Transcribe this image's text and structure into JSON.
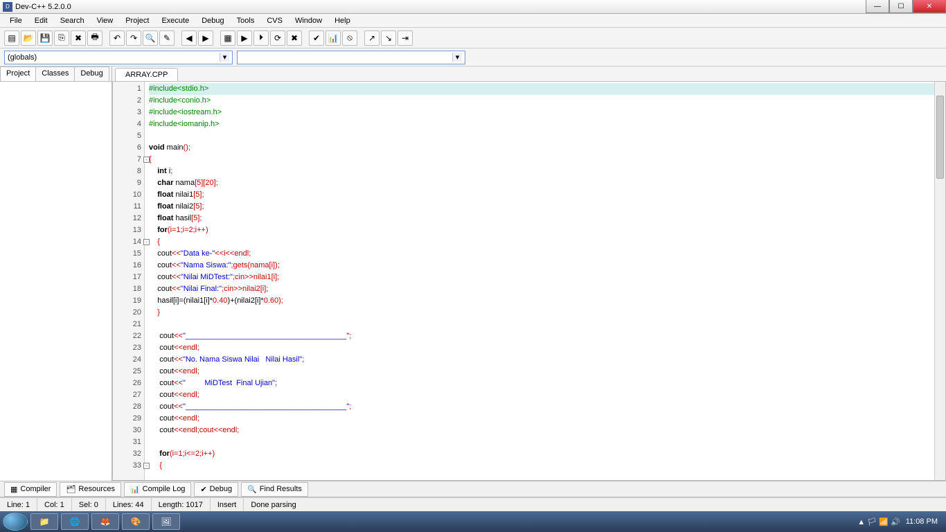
{
  "title": "Dev-C++ 5.2.0.0",
  "window_buttons": {
    "min": "—",
    "max": "☐",
    "close": "✕"
  },
  "menus": [
    "File",
    "Edit",
    "Search",
    "View",
    "Project",
    "Execute",
    "Debug",
    "Tools",
    "CVS",
    "Window",
    "Help"
  ],
  "toolbar_icons": [
    "new-file",
    "open-file",
    "save",
    "save-all",
    "close",
    "print",
    "",
    "undo",
    "redo",
    "find",
    "replace",
    "",
    "back",
    "forward",
    "",
    "compile",
    "run",
    "compile-run",
    "rebuild",
    "debug-btn",
    "",
    "check",
    "profile",
    "stop",
    "",
    "goto1",
    "goto2",
    "goto3"
  ],
  "combo1": "(globals)",
  "combo2": "",
  "left_tabs": [
    "Project",
    "Classes",
    "Debug"
  ],
  "editor_tab": "ARRAY.CPP",
  "code_lines": [
    {
      "n": 1,
      "hl": true,
      "segs": [
        {
          "t": "#include<stdio.h>",
          "c": "pre"
        }
      ]
    },
    {
      "n": 2,
      "segs": [
        {
          "t": "#include<conio.h>",
          "c": "pre"
        }
      ]
    },
    {
      "n": 3,
      "segs": [
        {
          "t": "#include<iostream.h>",
          "c": "pre"
        }
      ]
    },
    {
      "n": 4,
      "segs": [
        {
          "t": "#include<iomanip.h>",
          "c": "pre"
        }
      ]
    },
    {
      "n": 5,
      "segs": []
    },
    {
      "n": 6,
      "segs": [
        {
          "t": "void",
          "c": "kw"
        },
        {
          "t": " main",
          "c": "id"
        },
        {
          "t": "();",
          "c": "sym"
        }
      ]
    },
    {
      "n": 7,
      "fold": "-",
      "segs": [
        {
          "t": "{",
          "c": "sym"
        }
      ]
    },
    {
      "n": 8,
      "segs": [
        {
          "t": "    ",
          "c": "id"
        },
        {
          "t": "int",
          "c": "kw"
        },
        {
          "t": " i",
          "c": "id"
        },
        {
          "t": ";",
          "c": "sym"
        }
      ]
    },
    {
      "n": 9,
      "segs": [
        {
          "t": "    ",
          "c": "id"
        },
        {
          "t": "char",
          "c": "kw"
        },
        {
          "t": " nama",
          "c": "id"
        },
        {
          "t": "[",
          "c": "sym"
        },
        {
          "t": "5",
          "c": "num"
        },
        {
          "t": "][",
          "c": "sym"
        },
        {
          "t": "20",
          "c": "num"
        },
        {
          "t": "];",
          "c": "sym"
        }
      ]
    },
    {
      "n": 10,
      "segs": [
        {
          "t": "    ",
          "c": "id"
        },
        {
          "t": "float",
          "c": "kw"
        },
        {
          "t": " nilai1",
          "c": "id"
        },
        {
          "t": "[",
          "c": "sym"
        },
        {
          "t": "5",
          "c": "num"
        },
        {
          "t": "];",
          "c": "sym"
        }
      ]
    },
    {
      "n": 11,
      "segs": [
        {
          "t": "    ",
          "c": "id"
        },
        {
          "t": "float",
          "c": "kw"
        },
        {
          "t": " nilai2",
          "c": "id"
        },
        {
          "t": "[",
          "c": "sym"
        },
        {
          "t": "5",
          "c": "num"
        },
        {
          "t": "];",
          "c": "sym"
        }
      ]
    },
    {
      "n": 12,
      "segs": [
        {
          "t": "    ",
          "c": "id"
        },
        {
          "t": "float",
          "c": "kw"
        },
        {
          "t": " hasil",
          "c": "id"
        },
        {
          "t": "[",
          "c": "sym"
        },
        {
          "t": "5",
          "c": "num"
        },
        {
          "t": "];",
          "c": "sym"
        }
      ]
    },
    {
      "n": 13,
      "segs": [
        {
          "t": "    ",
          "c": "id"
        },
        {
          "t": "for",
          "c": "kw"
        },
        {
          "t": "(i=",
          "c": "sym"
        },
        {
          "t": "1",
          "c": "num"
        },
        {
          "t": ";i=",
          "c": "sym"
        },
        {
          "t": "2",
          "c": "num"
        },
        {
          "t": ";i++)",
          "c": "sym"
        }
      ]
    },
    {
      "n": 14,
      "fold": "-",
      "segs": [
        {
          "t": "    {",
          "c": "sym"
        }
      ]
    },
    {
      "n": 15,
      "segs": [
        {
          "t": "    cout",
          "c": "id"
        },
        {
          "t": "<<",
          "c": "sym"
        },
        {
          "t": "\"Data ke-\"",
          "c": "str"
        },
        {
          "t": "<<i<<endl;",
          "c": "sym"
        }
      ]
    },
    {
      "n": 16,
      "segs": [
        {
          "t": "    cout",
          "c": "id"
        },
        {
          "t": "<<",
          "c": "sym"
        },
        {
          "t": "\"Nama Siswa:\"",
          "c": "str"
        },
        {
          "t": ";gets(nama[i]);",
          "c": "sym"
        }
      ]
    },
    {
      "n": 17,
      "segs": [
        {
          "t": "    cout",
          "c": "id"
        },
        {
          "t": "<<",
          "c": "sym"
        },
        {
          "t": "\"Nilai MiDTest:\"",
          "c": "str"
        },
        {
          "t": ";cin>>nilai1[i];",
          "c": "sym"
        }
      ]
    },
    {
      "n": 18,
      "segs": [
        {
          "t": "    cout",
          "c": "id"
        },
        {
          "t": "<<",
          "c": "sym"
        },
        {
          "t": "\"Nilai Final:\"",
          "c": "str"
        },
        {
          "t": ";cin>>nilai2[i];",
          "c": "sym"
        }
      ]
    },
    {
      "n": 19,
      "segs": [
        {
          "t": "    hasil[i]=(nilai1[i]*",
          "c": "id"
        },
        {
          "t": "0.40",
          "c": "num"
        },
        {
          "t": ")+(nilai2[i]*",
          "c": "id"
        },
        {
          "t": "0.60",
          "c": "num"
        },
        {
          "t": ");",
          "c": "sym"
        }
      ]
    },
    {
      "n": 20,
      "segs": [
        {
          "t": "    }",
          "c": "sym"
        }
      ]
    },
    {
      "n": 21,
      "segs": []
    },
    {
      "n": 22,
      "segs": [
        {
          "t": "     cout",
          "c": "id"
        },
        {
          "t": "<<",
          "c": "sym"
        },
        {
          "t": "\"______________________________________\"",
          "c": "str"
        },
        {
          "t": ";",
          "c": "sym"
        }
      ]
    },
    {
      "n": 23,
      "segs": [
        {
          "t": "     cout",
          "c": "id"
        },
        {
          "t": "<<endl;",
          "c": "sym"
        }
      ]
    },
    {
      "n": 24,
      "segs": [
        {
          "t": "     cout",
          "c": "id"
        },
        {
          "t": "<<",
          "c": "sym"
        },
        {
          "t": "\"No. Nama Siswa Nilai   Nilai Hasil\"",
          "c": "str"
        },
        {
          "t": ";",
          "c": "sym"
        }
      ]
    },
    {
      "n": 25,
      "segs": [
        {
          "t": "     cout",
          "c": "id"
        },
        {
          "t": "<<endl;",
          "c": "sym"
        }
      ]
    },
    {
      "n": 26,
      "segs": [
        {
          "t": "     cout",
          "c": "id"
        },
        {
          "t": "<<",
          "c": "sym"
        },
        {
          "t": "\"         MiDTest  Final Ujian\"",
          "c": "str"
        },
        {
          "t": ";",
          "c": "sym"
        }
      ]
    },
    {
      "n": 27,
      "segs": [
        {
          "t": "     cout",
          "c": "id"
        },
        {
          "t": "<<endl;",
          "c": "sym"
        }
      ]
    },
    {
      "n": 28,
      "segs": [
        {
          "t": "     cout",
          "c": "id"
        },
        {
          "t": "<<",
          "c": "sym"
        },
        {
          "t": "\"______________________________________\"",
          "c": "str"
        },
        {
          "t": ";",
          "c": "sym"
        }
      ]
    },
    {
      "n": 29,
      "segs": [
        {
          "t": "     cout",
          "c": "id"
        },
        {
          "t": "<<endl;",
          "c": "sym"
        }
      ]
    },
    {
      "n": 30,
      "segs": [
        {
          "t": "     cout",
          "c": "id"
        },
        {
          "t": "<<endl;cout<<endl;",
          "c": "sym"
        }
      ]
    },
    {
      "n": 31,
      "segs": []
    },
    {
      "n": 32,
      "segs": [
        {
          "t": "     ",
          "c": "id"
        },
        {
          "t": "for",
          "c": "kw"
        },
        {
          "t": "(i=",
          "c": "sym"
        },
        {
          "t": "1",
          "c": "num"
        },
        {
          "t": ";i<=",
          "c": "sym"
        },
        {
          "t": "2",
          "c": "num"
        },
        {
          "t": ";i++)",
          "c": "sym"
        }
      ]
    },
    {
      "n": 33,
      "fold": "-",
      "segs": [
        {
          "t": "     {",
          "c": "sym"
        }
      ]
    }
  ],
  "bottom_tabs": [
    {
      "icon": "▦",
      "label": "Compiler"
    },
    {
      "icon": "🗂",
      "label": "Resources"
    },
    {
      "icon": "📊",
      "label": "Compile Log"
    },
    {
      "icon": "✔",
      "label": "Debug"
    },
    {
      "icon": "🔍",
      "label": "Find Results"
    }
  ],
  "status": {
    "line": "Line:   1",
    "col": "Col:   1",
    "sel": "Sel:   0",
    "lines": "Lines:   44",
    "length": "Length:  1017",
    "mode": "Insert",
    "parse": "Done parsing"
  },
  "taskbar": {
    "items": [
      "📁",
      "🌐",
      "🦊",
      "🎨",
      "🖼"
    ],
    "tray": [
      "▲",
      "🏳",
      "📶",
      "🔊"
    ],
    "time": "11:08 PM"
  }
}
